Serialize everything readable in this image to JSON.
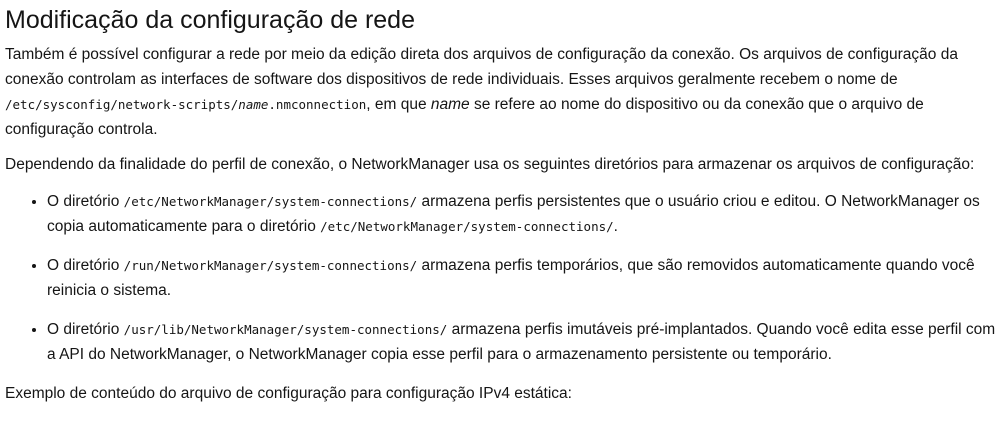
{
  "heading": "Modificação da configuração de rede",
  "intro": {
    "text_before_path": "Também é possível configurar a rede por meio da edição direta dos arquivos de configuração da conexão. Os arquivos de configuração da conexão controlam as interfaces de software dos dispositivos de rede individuais. Esses arquivos geralmente recebem o nome de ",
    "path_prefix": "/etc/sysconfig/network-scripts/",
    "path_var": "name",
    "path_suffix": ".nmconnection",
    "text_mid": ", em que ",
    "name_word": "name",
    "text_end": " se refere ao nome do dispositivo ou da conexão que o arquivo de configuração controla."
  },
  "directories_intro": "Dependendo da finalidade do perfil de conexão, o NetworkManager usa os seguintes diretórios para armazenar os arquivos de configuração:",
  "list": [
    {
      "lead": "O diretório ",
      "path": "/etc/NetworkManager/system-connections/",
      "text": " armazena perfis persistentes que o usuário criou e editou. O NetworkManager os copia automaticamente para o diretório ",
      "path2": "/etc/NetworkManager/system-connections/",
      "tail": "."
    },
    {
      "lead": "O diretório ",
      "path": "/run/NetworkManager/system-connections/",
      "text": " armazena perfis temporários, que são removidos automaticamente quando você reinicia o sistema."
    },
    {
      "lead": "O diretório ",
      "path": "/usr/lib/NetworkManager/system-connections/",
      "text": " armazena perfis imutáveis pré-implantados. Quando você edita esse perfil com a API do NetworkManager, o NetworkManager copia esse perfil para o armazenamento persistente ou temporário."
    }
  ],
  "example_caption": "Exemplo de conteúdo do arquivo de configuração para configuração IPv4 estática:"
}
